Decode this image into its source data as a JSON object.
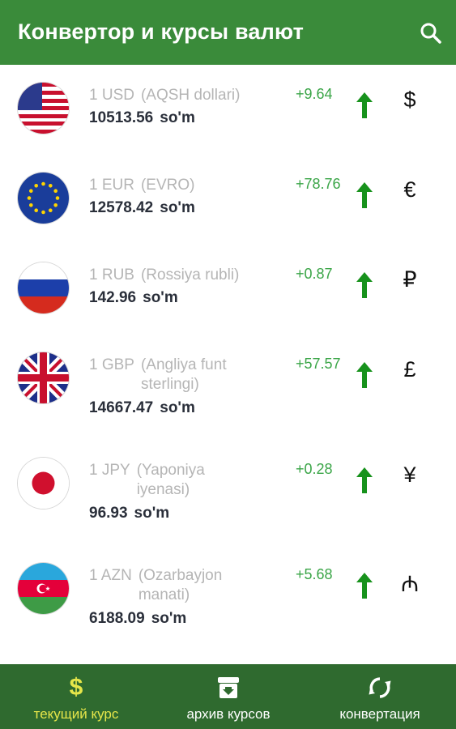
{
  "header": {
    "title": "Конвертор и курсы валют",
    "search_icon": "search-icon"
  },
  "currencies": [
    {
      "code": "1 USD",
      "name": "(AQSH dollari)",
      "rate": "10513.56",
      "unit": "so'm",
      "change": "+9.64",
      "trend": "up",
      "symbol": "$",
      "flag": "us-flag-icon"
    },
    {
      "code": "1 EUR",
      "name": "(EVRO)",
      "rate": "12578.42",
      "unit": "so'm",
      "change": "+78.76",
      "trend": "up",
      "symbol": "€",
      "flag": "eu-flag-icon"
    },
    {
      "code": "1 RUB",
      "name": "(Rossiya rubli)",
      "rate": "142.96",
      "unit": "so'm",
      "change": "+0.87",
      "trend": "up",
      "symbol": "₽",
      "flag": "ru-flag-icon"
    },
    {
      "code": "1 GBP",
      "name": "(Angliya funt sterlingi)",
      "rate": "14667.47",
      "unit": "so'm",
      "change": "+57.57",
      "trend": "up",
      "symbol": "£",
      "flag": "gb-flag-icon"
    },
    {
      "code": "1 JPY",
      "name": "(Yaponiya iyenasi)",
      "rate": "96.93",
      "unit": "so'm",
      "change": "+0.28",
      "trend": "up",
      "symbol": "¥",
      "flag": "jp-flag-icon"
    },
    {
      "code": "1 AZN",
      "name": "(Ozarbayjon manati)",
      "rate": "6188.09",
      "unit": "so'm",
      "change": "+5.68",
      "trend": "up",
      "symbol": "₼",
      "flag": "az-flag-icon"
    }
  ],
  "bottom_nav": {
    "current_rate": {
      "icon": "$",
      "label": "текущий курс"
    },
    "archive": {
      "icon": "archive-icon",
      "label": "архив курсов"
    },
    "convert": {
      "icon": "sync-icon",
      "label": "конвертация"
    }
  },
  "colors": {
    "header_green": "#3a8b3a",
    "nav_green": "#2f6a2f",
    "active_tab": "#e6e64a",
    "positive_change": "#3aa547",
    "arrow_green": "#17921c"
  }
}
